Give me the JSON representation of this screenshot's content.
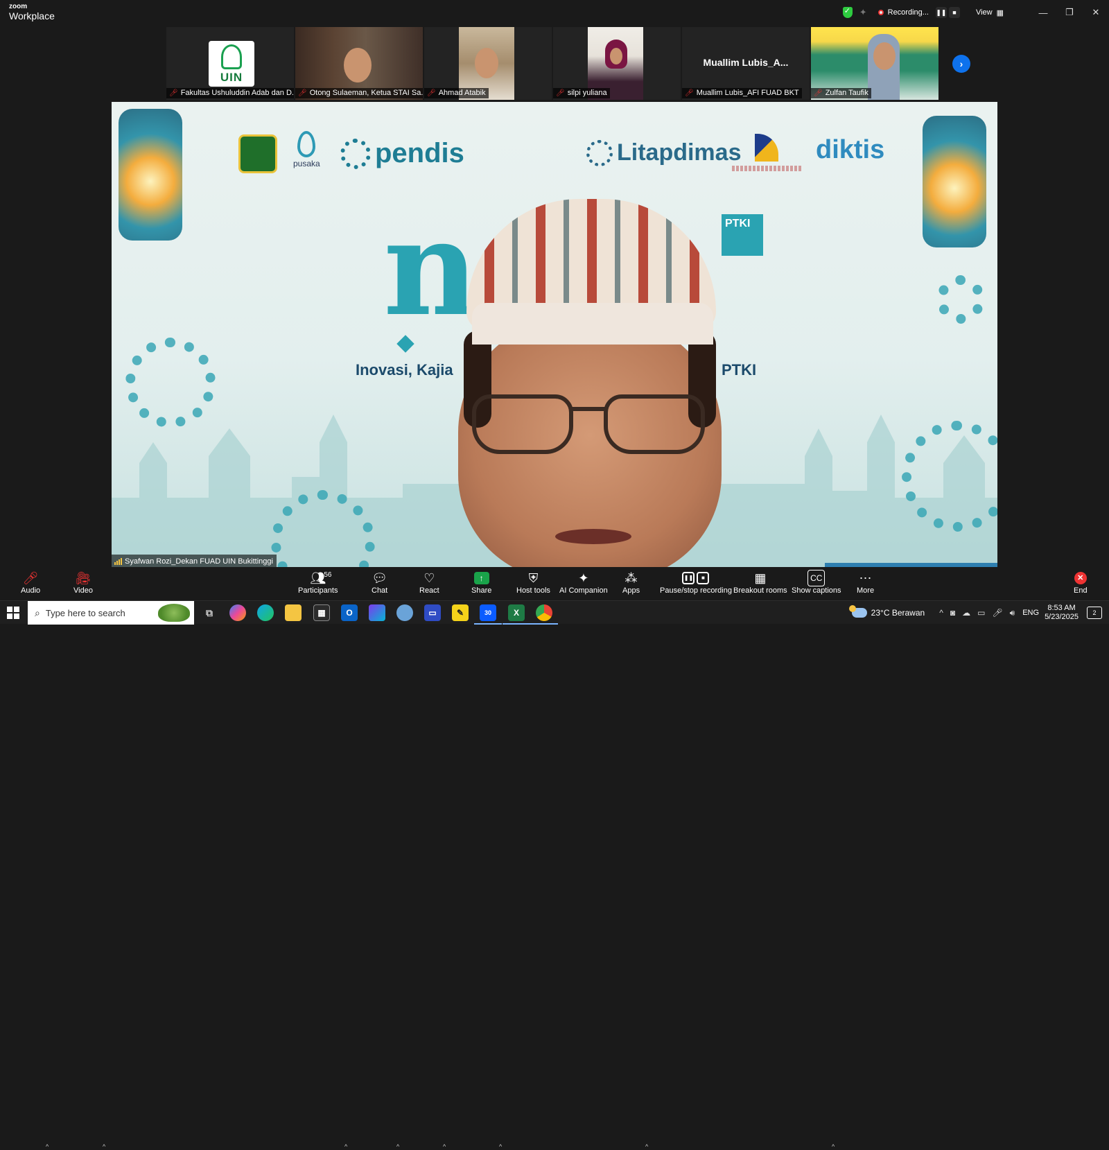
{
  "app": {
    "brand_top": "zoom",
    "brand_bottom": "Workplace"
  },
  "titlebar": {
    "recording_label": "Recording...",
    "view_label": "View",
    "window_controls": [
      "minimize",
      "restore",
      "close"
    ]
  },
  "thumbnails": [
    {
      "name": "Fakultas Ushuluddin Adab dan D...",
      "logo_text": "UIN",
      "muted": true
    },
    {
      "name": "Otong Sulaeman, Ketua STAI Sa...",
      "muted": true
    },
    {
      "name": "Ahmad Atabik",
      "muted": true
    },
    {
      "name": "silpi yuliana",
      "muted": true
    },
    {
      "name": "Muallim Lubis_AFI FUAD BKT",
      "display_text": "Muallim  Lubis_A...",
      "muted": true
    },
    {
      "name": "Zulfan Taufik",
      "muted": true
    }
  ],
  "slide": {
    "logos": [
      "pusaka",
      "pendis",
      "Litapdimas",
      "diktis"
    ],
    "ptki_badge": "PTKI",
    "line_left": "Inovasi, Kajia",
    "line_right": "PTKI"
  },
  "speaker": {
    "name": "Syafwan Rozi_Dekan FUAD UIN Bukittinggi"
  },
  "toolbar": {
    "audio": "Audio",
    "video": "Video",
    "participants": "Participants",
    "participants_count": "56",
    "chat": "Chat",
    "react": "React",
    "share": "Share",
    "host_tools": "Host tools",
    "ai_companion": "AI Companion",
    "apps": "Apps",
    "pause_stop": "Pause/stop recording",
    "breakout": "Breakout rooms",
    "captions": "Show captions",
    "more": "More",
    "end": "End"
  },
  "taskbar": {
    "search_placeholder": "Type here to search",
    "weather": "23°C  Berawan",
    "lang": "ENG",
    "time": "8:53 AM",
    "date": "5/23/2025",
    "zoom_badge": "30",
    "notif_count": "2"
  },
  "colors": {
    "accent": "#0e72ed",
    "share": "#1aa34a",
    "end": "#e33333",
    "toolbar_bg": "#1a1a1a"
  }
}
